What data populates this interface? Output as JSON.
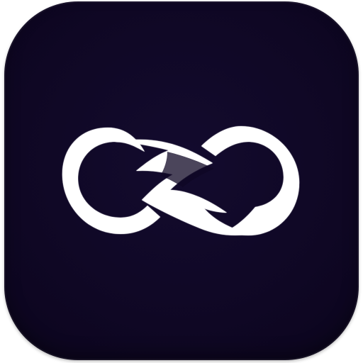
{
  "app_icon": {
    "icon_name": "infinity-lightning-logo-icon",
    "background_color": "#0f0724",
    "logo_color": "#ffffff"
  }
}
